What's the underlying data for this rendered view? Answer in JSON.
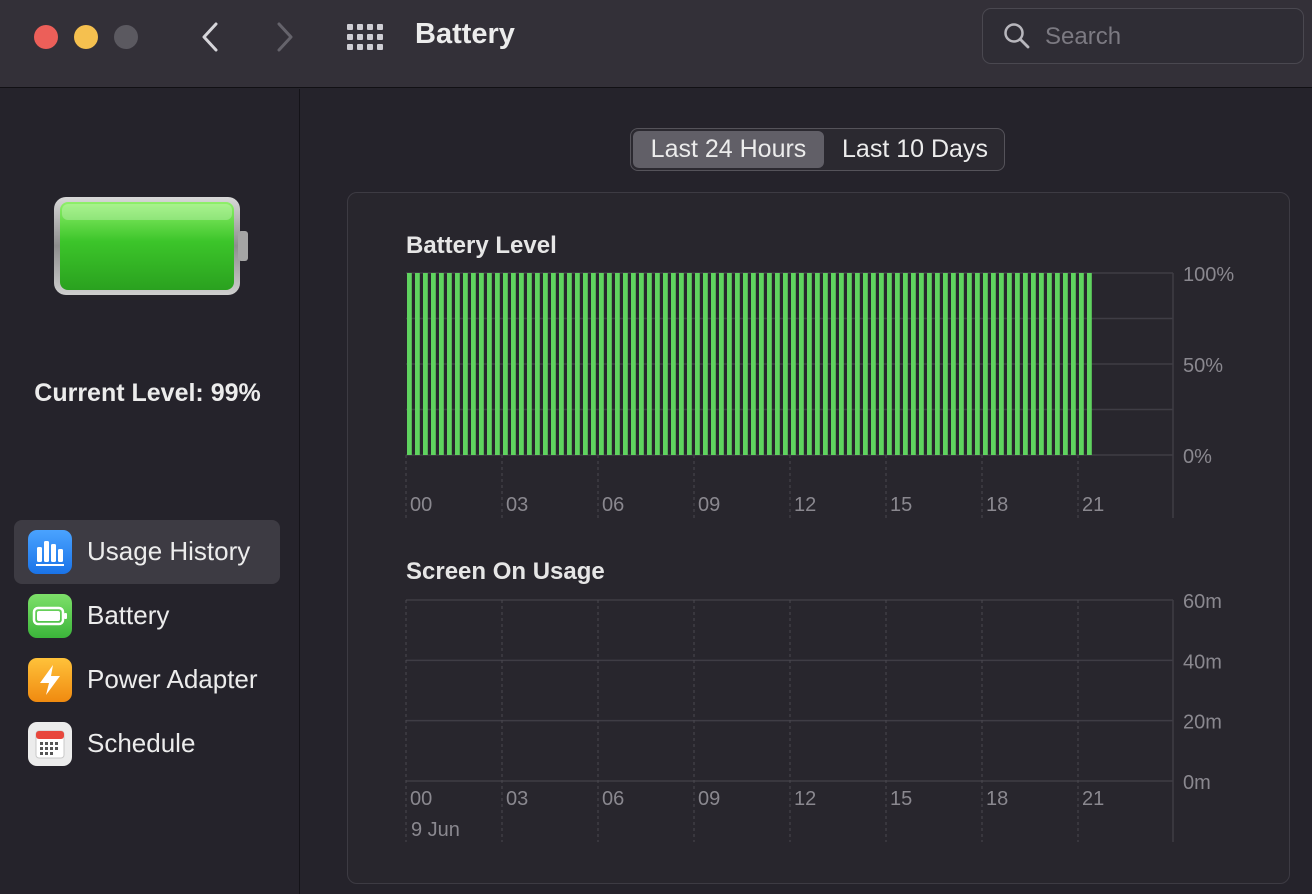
{
  "window": {
    "title": "Battery",
    "search_placeholder": "Search"
  },
  "sidebar": {
    "current_level": "Current Level: 99%",
    "items": [
      {
        "label": "Usage History",
        "icon": "usage-history-icon",
        "selected": true
      },
      {
        "label": "Battery",
        "icon": "battery-icon",
        "selected": false
      },
      {
        "label": "Power Adapter",
        "icon": "power-adapter-icon",
        "selected": false
      },
      {
        "label": "Schedule",
        "icon": "schedule-icon",
        "selected": false
      }
    ]
  },
  "tabs": [
    {
      "label": "Last 24 Hours",
      "selected": true
    },
    {
      "label": "Last 10 Days",
      "selected": false
    }
  ],
  "colors": {
    "bar_green": "#5fd35f",
    "close": "#ec5f59",
    "minimize": "#f5c04f",
    "zoom_disabled": "#5b5960"
  },
  "chart_data": [
    {
      "type": "bar",
      "title": "Battery Level",
      "x_ticks": [
        "00",
        "03",
        "06",
        "09",
        "12",
        "15",
        "18",
        "21"
      ],
      "y_ticks": [
        "100%",
        "50%",
        "0%"
      ],
      "ylim": [
        0,
        100
      ],
      "unit": "%",
      "bar_count": 86,
      "values_summary": "all bars at 100% from 00 to just past 21",
      "value": 100
    },
    {
      "type": "bar",
      "title": "Screen On Usage",
      "x_ticks": [
        "00",
        "03",
        "06",
        "09",
        "12",
        "15",
        "18",
        "21"
      ],
      "x_date_label": "9 Jun",
      "y_ticks": [
        "60m",
        "40m",
        "20m",
        "0m"
      ],
      "ylim": [
        0,
        60
      ],
      "values": []
    }
  ]
}
